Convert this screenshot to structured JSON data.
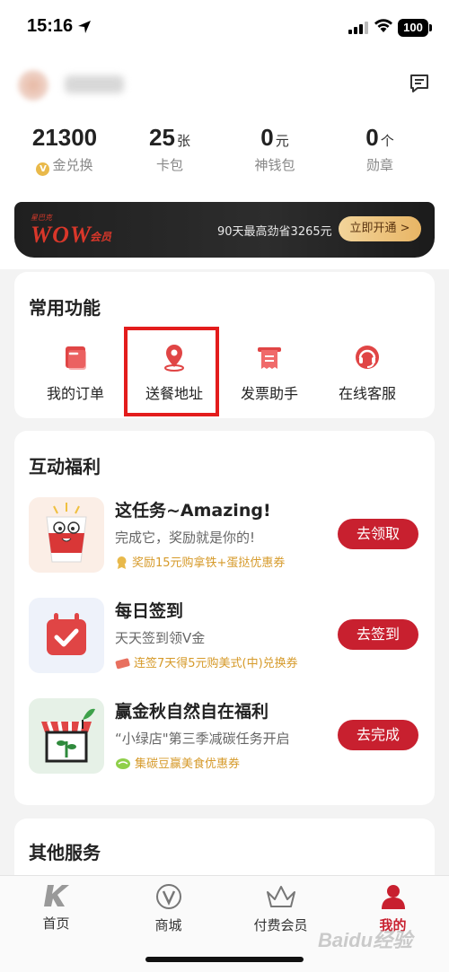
{
  "status_bar": {
    "time": "15:16",
    "battery": "100"
  },
  "stats": [
    {
      "value": "21300",
      "unit": "",
      "label": "金兑换",
      "coin": "V"
    },
    {
      "value": "25",
      "unit": "张",
      "label": "卡包"
    },
    {
      "value": "0",
      "unit": "元",
      "label": "神钱包"
    },
    {
      "value": "0",
      "unit": "个",
      "label": "勋章"
    }
  ],
  "wow_banner": {
    "subtitle": "星巴克",
    "logo": "WOW",
    "member": "会员",
    "promo": "90天最高劲省3265元",
    "button": "立即开通 >"
  },
  "common_functions": {
    "title": "常用功能",
    "items": [
      {
        "label": "我的订单",
        "icon": "order-icon"
      },
      {
        "label": "送餐地址",
        "icon": "location-pin-icon"
      },
      {
        "label": "发票助手",
        "icon": "invoice-icon"
      },
      {
        "label": "在线客服",
        "icon": "headset-icon"
      }
    ]
  },
  "benefits": {
    "title": "互动福利",
    "tasks": [
      {
        "title": "这任务~Amazing!",
        "desc": "完成它，奖励就是你的!",
        "reward": "奖励15元购拿铁+蛋挞优惠券",
        "button": "去领取"
      },
      {
        "title": "每日签到",
        "desc": "天天签到领V金",
        "reward": "连签7天得5元购美式(中)兑换券",
        "button": "去签到"
      },
      {
        "title": "赢金秋自然自在福利",
        "desc": "“小绿店\"第三季减碳任务开启",
        "reward": "集碳豆赢美食优惠券",
        "button": "去完成"
      }
    ]
  },
  "other_services": {
    "title": "其他服务"
  },
  "bottom_nav": [
    {
      "label": "首页",
      "icon": "home-k-icon"
    },
    {
      "label": "商城",
      "icon": "mall-v-icon"
    },
    {
      "label": "付费会员",
      "icon": "crown-icon"
    },
    {
      "label": "我的",
      "icon": "profile-icon",
      "active": true
    }
  ],
  "watermark": "Baidu经验",
  "colors": {
    "accent": "#c8202f",
    "highlight": "#e31c1c",
    "reward": "#d69a2a"
  }
}
